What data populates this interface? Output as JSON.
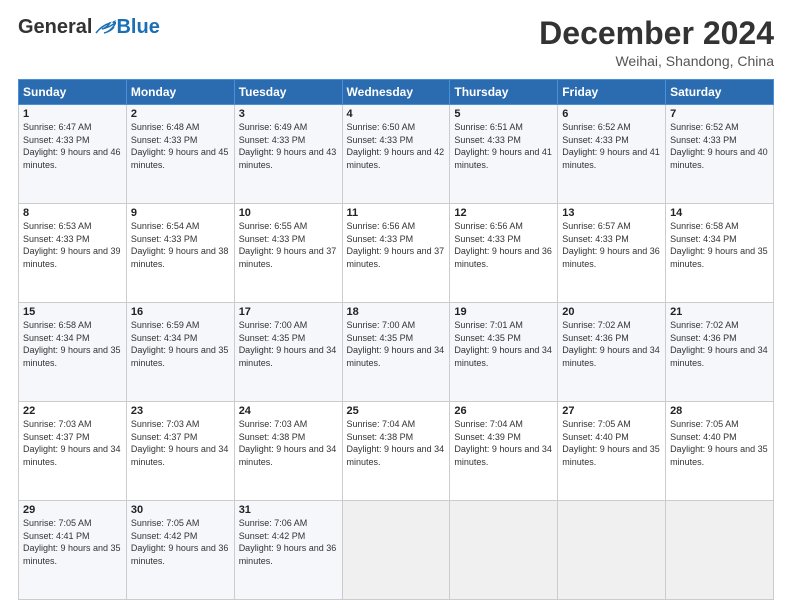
{
  "header": {
    "logo_general": "General",
    "logo_blue": "Blue",
    "month_title": "December 2024",
    "location": "Weihai, Shandong, China"
  },
  "days_of_week": [
    "Sunday",
    "Monday",
    "Tuesday",
    "Wednesday",
    "Thursday",
    "Friday",
    "Saturday"
  ],
  "weeks": [
    [
      {
        "day": 1,
        "sunrise": "6:47 AM",
        "sunset": "4:33 PM",
        "daylight": "9 hours and 46 minutes."
      },
      {
        "day": 2,
        "sunrise": "6:48 AM",
        "sunset": "4:33 PM",
        "daylight": "9 hours and 45 minutes."
      },
      {
        "day": 3,
        "sunrise": "6:49 AM",
        "sunset": "4:33 PM",
        "daylight": "9 hours and 43 minutes."
      },
      {
        "day": 4,
        "sunrise": "6:50 AM",
        "sunset": "4:33 PM",
        "daylight": "9 hours and 42 minutes."
      },
      {
        "day": 5,
        "sunrise": "6:51 AM",
        "sunset": "4:33 PM",
        "daylight": "9 hours and 41 minutes."
      },
      {
        "day": 6,
        "sunrise": "6:52 AM",
        "sunset": "4:33 PM",
        "daylight": "9 hours and 41 minutes."
      },
      {
        "day": 7,
        "sunrise": "6:52 AM",
        "sunset": "4:33 PM",
        "daylight": "9 hours and 40 minutes."
      }
    ],
    [
      {
        "day": 8,
        "sunrise": "6:53 AM",
        "sunset": "4:33 PM",
        "daylight": "9 hours and 39 minutes."
      },
      {
        "day": 9,
        "sunrise": "6:54 AM",
        "sunset": "4:33 PM",
        "daylight": "9 hours and 38 minutes."
      },
      {
        "day": 10,
        "sunrise": "6:55 AM",
        "sunset": "4:33 PM",
        "daylight": "9 hours and 37 minutes."
      },
      {
        "day": 11,
        "sunrise": "6:56 AM",
        "sunset": "4:33 PM",
        "daylight": "9 hours and 37 minutes."
      },
      {
        "day": 12,
        "sunrise": "6:56 AM",
        "sunset": "4:33 PM",
        "daylight": "9 hours and 36 minutes."
      },
      {
        "day": 13,
        "sunrise": "6:57 AM",
        "sunset": "4:33 PM",
        "daylight": "9 hours and 36 minutes."
      },
      {
        "day": 14,
        "sunrise": "6:58 AM",
        "sunset": "4:34 PM",
        "daylight": "9 hours and 35 minutes."
      }
    ],
    [
      {
        "day": 15,
        "sunrise": "6:58 AM",
        "sunset": "4:34 PM",
        "daylight": "9 hours and 35 minutes."
      },
      {
        "day": 16,
        "sunrise": "6:59 AM",
        "sunset": "4:34 PM",
        "daylight": "9 hours and 35 minutes."
      },
      {
        "day": 17,
        "sunrise": "7:00 AM",
        "sunset": "4:35 PM",
        "daylight": "9 hours and 34 minutes."
      },
      {
        "day": 18,
        "sunrise": "7:00 AM",
        "sunset": "4:35 PM",
        "daylight": "9 hours and 34 minutes."
      },
      {
        "day": 19,
        "sunrise": "7:01 AM",
        "sunset": "4:35 PM",
        "daylight": "9 hours and 34 minutes."
      },
      {
        "day": 20,
        "sunrise": "7:02 AM",
        "sunset": "4:36 PM",
        "daylight": "9 hours and 34 minutes."
      },
      {
        "day": 21,
        "sunrise": "7:02 AM",
        "sunset": "4:36 PM",
        "daylight": "9 hours and 34 minutes."
      }
    ],
    [
      {
        "day": 22,
        "sunrise": "7:03 AM",
        "sunset": "4:37 PM",
        "daylight": "9 hours and 34 minutes."
      },
      {
        "day": 23,
        "sunrise": "7:03 AM",
        "sunset": "4:37 PM",
        "daylight": "9 hours and 34 minutes."
      },
      {
        "day": 24,
        "sunrise": "7:03 AM",
        "sunset": "4:38 PM",
        "daylight": "9 hours and 34 minutes."
      },
      {
        "day": 25,
        "sunrise": "7:04 AM",
        "sunset": "4:38 PM",
        "daylight": "9 hours and 34 minutes."
      },
      {
        "day": 26,
        "sunrise": "7:04 AM",
        "sunset": "4:39 PM",
        "daylight": "9 hours and 34 minutes."
      },
      {
        "day": 27,
        "sunrise": "7:05 AM",
        "sunset": "4:40 PM",
        "daylight": "9 hours and 35 minutes."
      },
      {
        "day": 28,
        "sunrise": "7:05 AM",
        "sunset": "4:40 PM",
        "daylight": "9 hours and 35 minutes."
      }
    ],
    [
      {
        "day": 29,
        "sunrise": "7:05 AM",
        "sunset": "4:41 PM",
        "daylight": "9 hours and 35 minutes."
      },
      {
        "day": 30,
        "sunrise": "7:05 AM",
        "sunset": "4:42 PM",
        "daylight": "9 hours and 36 minutes."
      },
      {
        "day": 31,
        "sunrise": "7:06 AM",
        "sunset": "4:42 PM",
        "daylight": "9 hours and 36 minutes."
      },
      null,
      null,
      null,
      null
    ]
  ],
  "labels": {
    "sunrise": "Sunrise:",
    "sunset": "Sunset:",
    "daylight": "Daylight:"
  }
}
